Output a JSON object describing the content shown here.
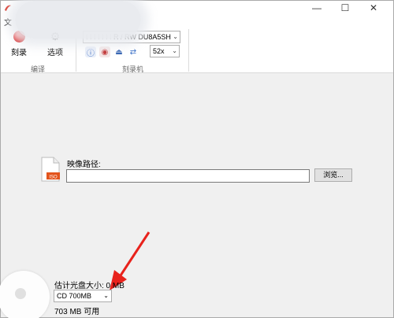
{
  "menu": {
    "file": "文"
  },
  "window_controls": {
    "minimize": "—",
    "maximize": "☐",
    "close": "✕"
  },
  "ribbon": {
    "record_label": "刻录",
    "options_label": "选项",
    "group_encode": "编译",
    "drive": "R / RW DU8A5SH",
    "drive_prefix": "I I I I I I I",
    "speed": "52x",
    "group_burner": "刻录机"
  },
  "content": {
    "file_badge": "ISO",
    "image_path_label": "映像路径:",
    "image_path_value": "",
    "browse_label": "浏览..."
  },
  "disc": {
    "estimated_size": "估计光盘大小: 0 MB",
    "media_type": "CD 700MB",
    "available": "703 MB 可用"
  },
  "colors": {
    "accent_red": "#d01010",
    "arrow_red": "#e8221c"
  }
}
